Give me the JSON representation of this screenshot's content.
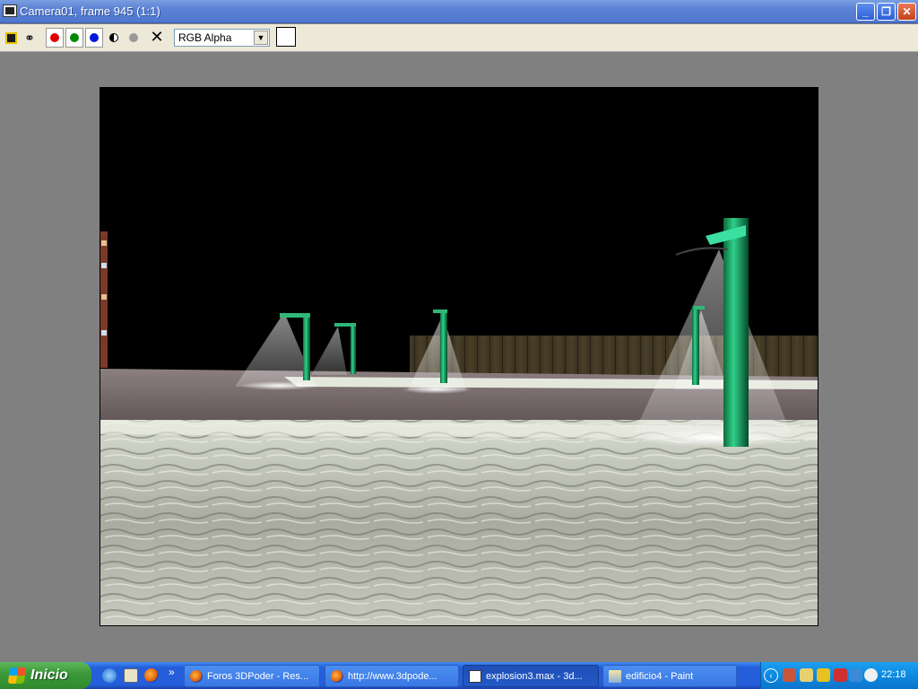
{
  "window": {
    "title": "Camera01, frame 945 (1:1)",
    "minimize_glyph": "_",
    "restore_glyph": "❐",
    "close_glyph": "✕"
  },
  "toolbar": {
    "save_icon": "save-icon",
    "clone_icon": "clone-window-icon",
    "channels": [
      {
        "name": "red",
        "color": "#e00000"
      },
      {
        "name": "green",
        "color": "#008a00"
      },
      {
        "name": "blue",
        "color": "#0018d8"
      }
    ],
    "clear_glyph": "✕",
    "channel_select_value": "RGB Alpha",
    "swatch_color": "#ffffff"
  },
  "colors": {
    "title_bar": "#5b82d6",
    "toolbar_bg": "#ece9d8",
    "workspace_bg": "#808080",
    "taskbar": "#245edb",
    "start_button": "#3c9a3a"
  },
  "taskbar": {
    "start_label": "Inicio",
    "quicklaunch_more": "»",
    "tasks": [
      {
        "label": "Foros 3DPoder - Res...",
        "icon": "firefox-icon",
        "active": false
      },
      {
        "label": "http://www.3dpode...",
        "icon": "firefox-icon",
        "active": false
      },
      {
        "label": "explosion3.max - 3d...",
        "icon": "3dsmax-icon",
        "active": true
      },
      {
        "label": "edificio4 - Paint",
        "icon": "paint-icon",
        "active": false
      }
    ],
    "tray_chevron": "‹",
    "clock": "22:18"
  }
}
